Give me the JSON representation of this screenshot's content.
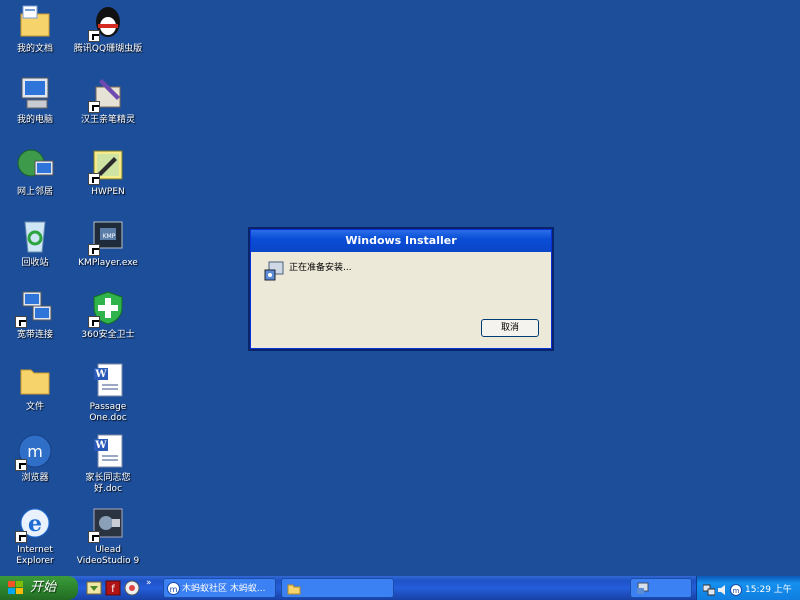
{
  "desktop": {
    "icons": [
      {
        "label": "我的文档"
      },
      {
        "label": "腾讯QQ珊瑚虫版"
      },
      {
        "label": "我的电脑"
      },
      {
        "label": "汉王亲笔精灵"
      },
      {
        "label": "网上邻居"
      },
      {
        "label": "HWPEN"
      },
      {
        "label": "回收站"
      },
      {
        "label": "KMPlayer.exe"
      },
      {
        "label": "宽带连接"
      },
      {
        "label": "360安全卫士"
      },
      {
        "label": "文件"
      },
      {
        "label": "Passage One.doc"
      },
      {
        "label": "浏览器"
      },
      {
        "label": "家长同志您好.doc"
      },
      {
        "label": "Internet Explorer"
      },
      {
        "label": "Ulead VideoStudio 9"
      }
    ]
  },
  "dialog": {
    "title": "Windows Installer",
    "message": "正在准备安装...",
    "cancel_label": "取消"
  },
  "taskbar": {
    "start_label": "开始",
    "more_label": "»",
    "task_1_label": "木蚂蚁社区 木蚂蚁...",
    "clock": "15:29 上午"
  }
}
